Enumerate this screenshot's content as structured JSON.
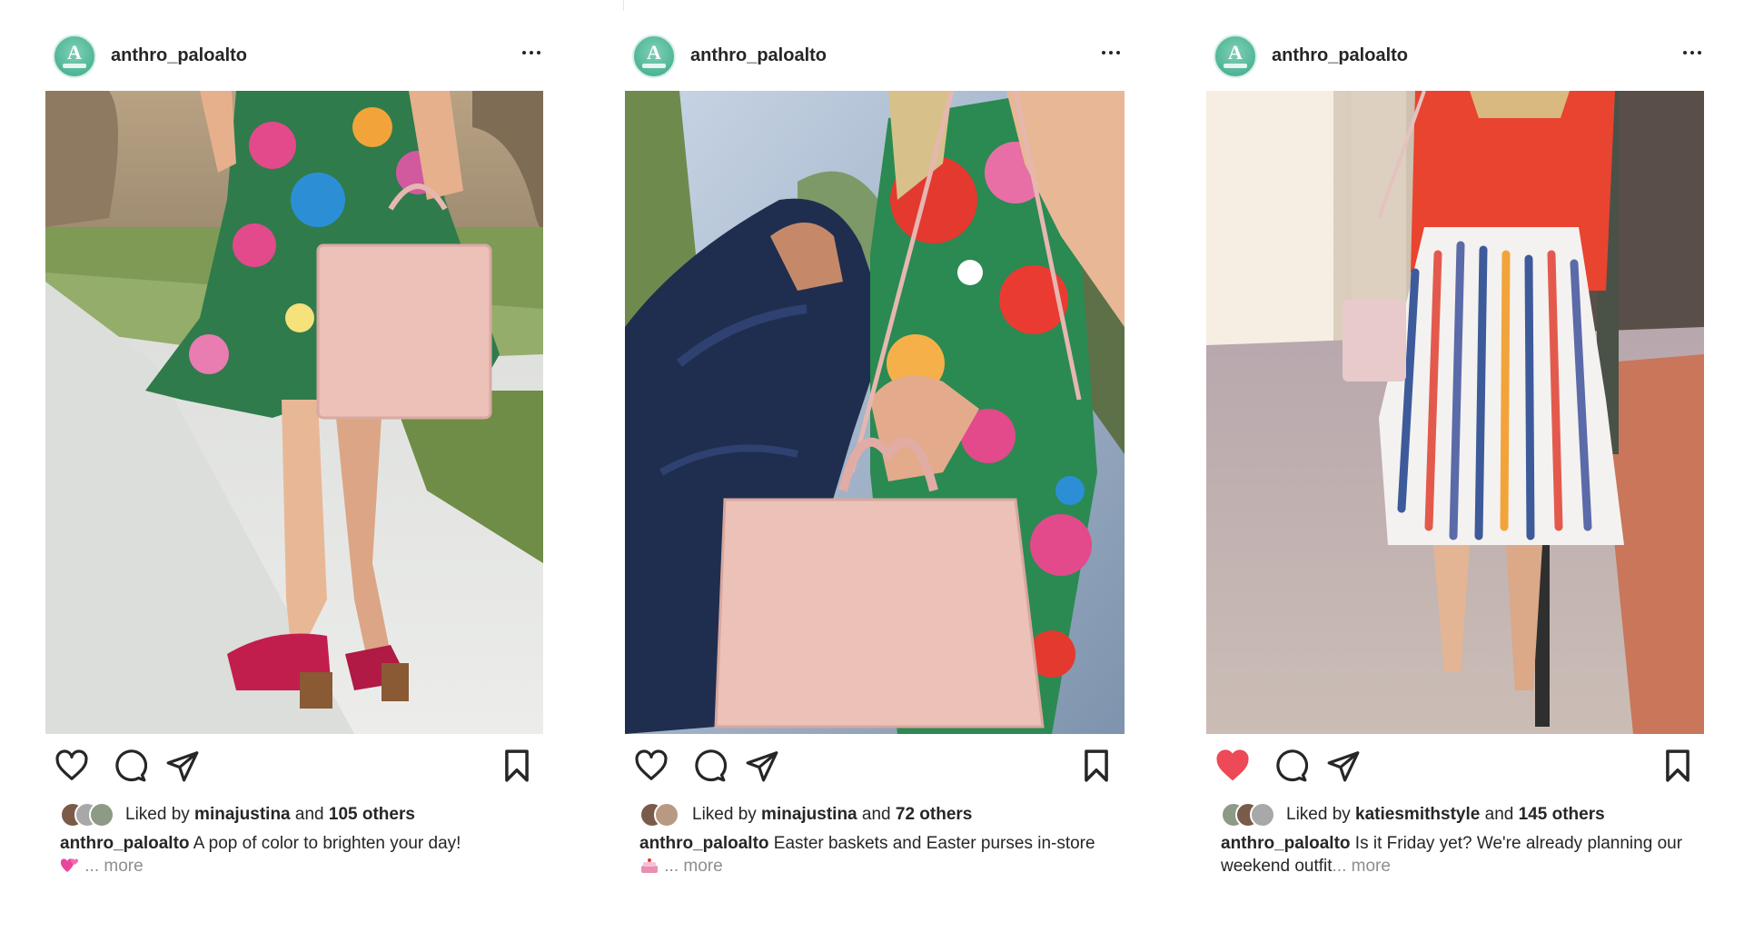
{
  "colors": {
    "text": "#262626",
    "muted": "#8e8e8e",
    "liked_heart": "#ed4956",
    "avatar_green": "#4fb596"
  },
  "posts": [
    {
      "avatar_letter": "A",
      "username": "anthro_paloalto",
      "more_icon": "more-horizontal-icon",
      "liked": false,
      "likes": {
        "prefix": "Liked by ",
        "liker": "minajustina",
        "connector": " and ",
        "others": "105 others"
      },
      "caption": {
        "user": "anthro_paloalto",
        "text": " A pop of color to brighten your day! ",
        "emoji": "two-hearts-emoji",
        "ellipsis": "... ",
        "more": "more"
      }
    },
    {
      "avatar_letter": "A",
      "username": "anthro_paloalto",
      "more_icon": "more-horizontal-icon",
      "liked": false,
      "likes": {
        "prefix": "Liked by ",
        "liker": "minajustina",
        "connector": " and ",
        "others": "72 others"
      },
      "caption": {
        "user": "anthro_paloalto",
        "text": " Easter baskets and Easter purses in-store ",
        "emoji": "cake-emoji",
        "ellipsis": "... ",
        "more": "more"
      }
    },
    {
      "avatar_letter": "A",
      "username": "anthro_paloalto",
      "more_icon": "more-horizontal-icon",
      "liked": true,
      "likes": {
        "prefix": "Liked by ",
        "liker": "katiesmithstyle",
        "connector": " and ",
        "others": "145 others"
      },
      "caption": {
        "user": "anthro_paloalto",
        "text": " Is it Friday yet? We're already planning our weekend outfit",
        "emoji": "",
        "ellipsis": "... ",
        "more": "more"
      }
    }
  ]
}
